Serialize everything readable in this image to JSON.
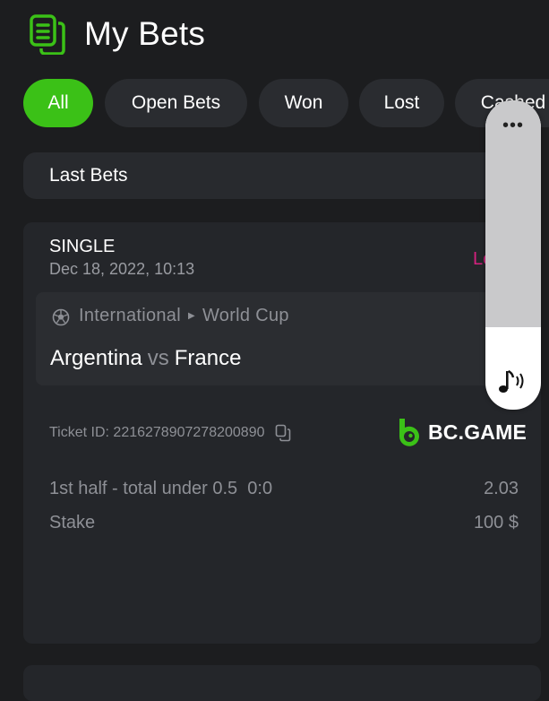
{
  "header": {
    "title": "My Bets",
    "icon": "document-list-icon"
  },
  "tabs": [
    {
      "label": "All",
      "active": true
    },
    {
      "label": "Open Bets",
      "active": false
    },
    {
      "label": "Won",
      "active": false
    },
    {
      "label": "Lost",
      "active": false
    },
    {
      "label": "Cashed",
      "active": false
    }
  ],
  "section": {
    "label": "Last Bets"
  },
  "bet": {
    "type": "SINGLE",
    "date": "Dec 18, 2022, 10:13",
    "status": "Lost",
    "league": {
      "country": "International",
      "competition": "World Cup"
    },
    "teams": {
      "home": "Argentina",
      "vs": "vs",
      "away": "France"
    },
    "ticket_label": "Ticket ID: 2216278907278200890",
    "brand": "BC.GAME",
    "selection": {
      "label": "1st half - total under 0.5",
      "score": "0:0",
      "odds": "2.03"
    },
    "stake": {
      "label": "Stake",
      "value": "100 $"
    }
  },
  "overlay": {
    "menu_icon": "more-dots-icon",
    "volume_icon": "music-volume-icon"
  },
  "colors": {
    "background": "#1c1d1f",
    "accent": "#3bc117",
    "lost": "#d4217f",
    "card": "#24262a"
  }
}
